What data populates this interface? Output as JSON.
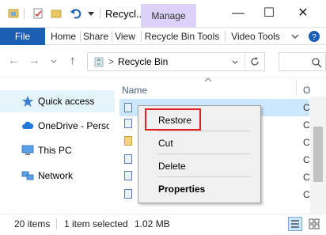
{
  "titlebar": {
    "title": "Recycl...",
    "manage_tab": "Manage",
    "qa_icons": [
      "save-icon",
      "properties-icon",
      "undo-icon",
      "dropdown-icon"
    ],
    "window_controls": [
      "minimize-icon",
      "maximize-icon",
      "close-icon"
    ]
  },
  "ribbon": {
    "file": "File",
    "tabs": [
      "Home",
      "Share",
      "View",
      "Recycle Bin Tools",
      "Video Tools"
    ],
    "help_icon": "help-icon"
  },
  "address": {
    "path": "Recycle Bin",
    "separator": ">"
  },
  "nav": {
    "items": [
      {
        "label": "Quick access",
        "icon": "star-icon"
      },
      {
        "label": "OneDrive - Perso",
        "icon": "cloud-icon"
      },
      {
        "label": "This PC",
        "icon": "pc-icon"
      },
      {
        "label": "Network",
        "icon": "network-icon"
      }
    ]
  },
  "content": {
    "column_name": "Name",
    "column_other": "O",
    "row_c": [
      "C",
      "C",
      "C",
      "C",
      "C",
      "C",
      "C",
      "C"
    ]
  },
  "context_menu": {
    "restore": "Restore",
    "cut": "Cut",
    "delete": "Delete",
    "properties": "Properties"
  },
  "status": {
    "items_count": "20 items",
    "selection": "1 item selected",
    "size": "1.02 MB"
  },
  "colors": {
    "accent": "#1a5fb4",
    "manage_tab_bg": "#dcd2f7",
    "selection": "#cce8ff",
    "highlight_border": "#e02020"
  }
}
